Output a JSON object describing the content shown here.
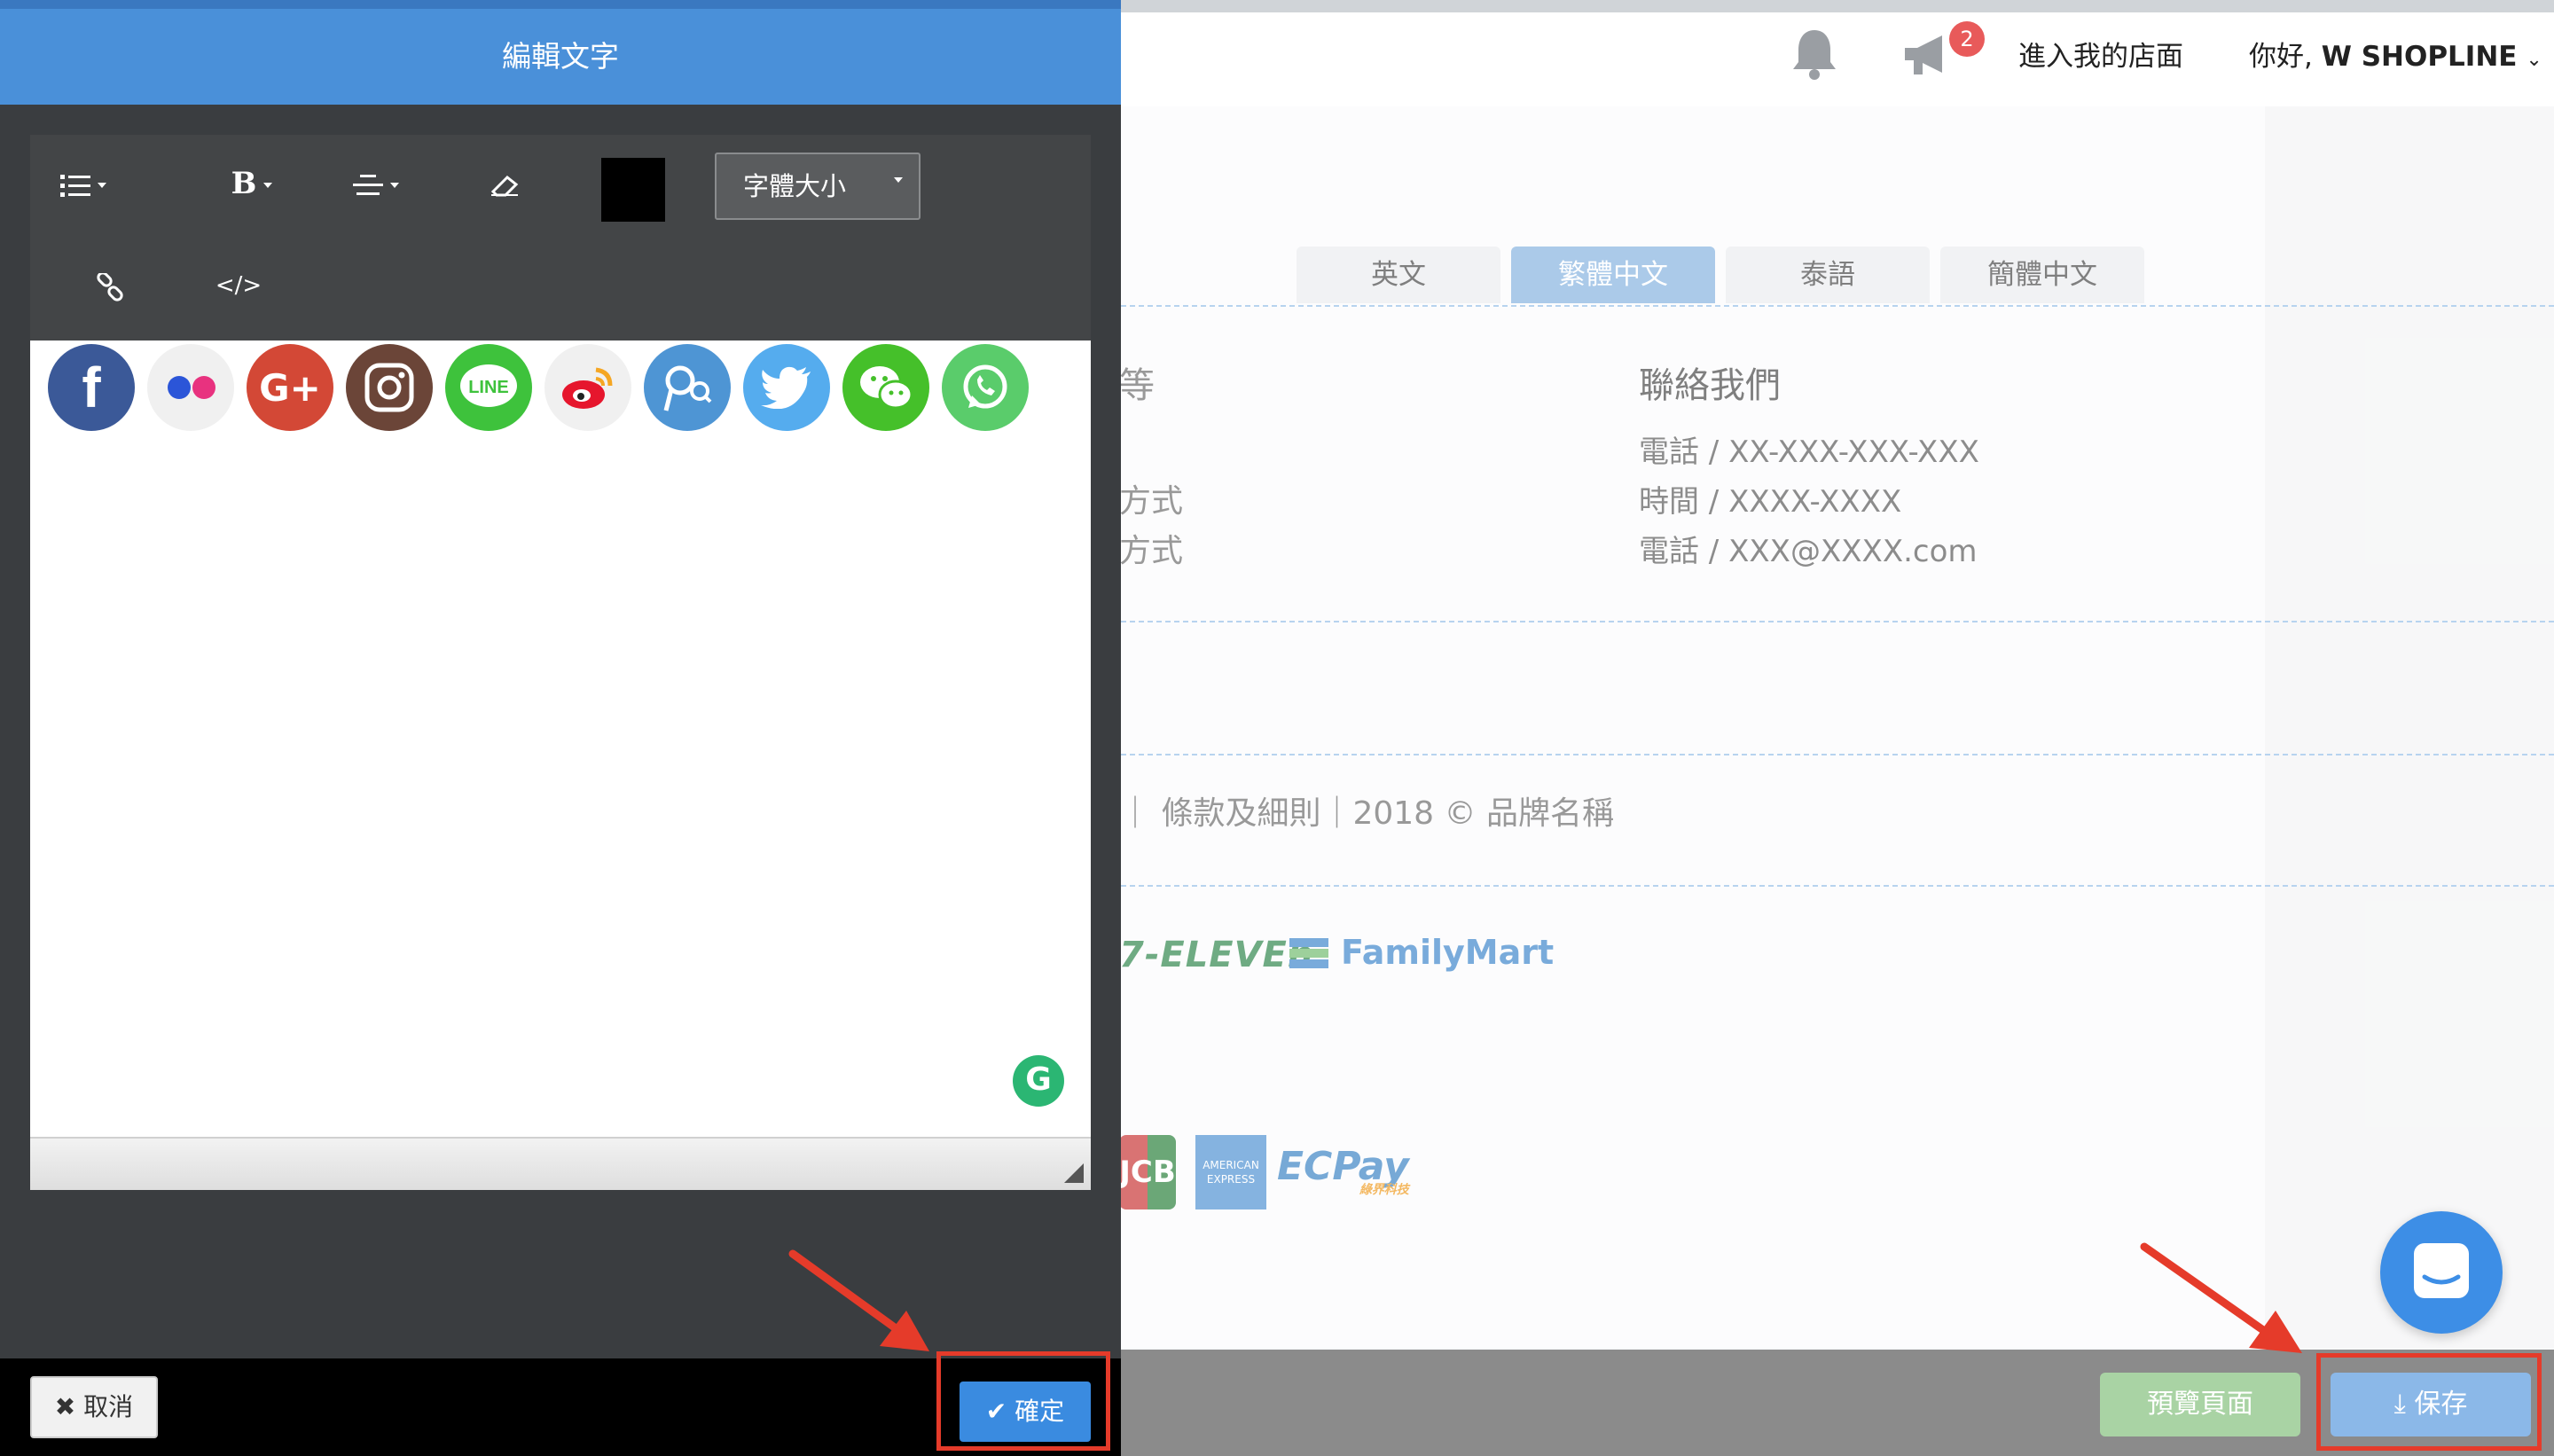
{
  "modal": {
    "title": "編輯文字",
    "toolbar": {
      "font_size_label": "字體大小",
      "text_color": "#000000"
    },
    "editor": {
      "social_icons": [
        "facebook-icon",
        "flickr-icon",
        "google-plus-icon",
        "instagram-icon",
        "line-icon",
        "weibo-icon",
        "pixnet-icon",
        "twitter-icon",
        "wechat-icon",
        "whatsapp-icon"
      ],
      "grammarly_label": "G"
    },
    "footer": {
      "cancel_label": "取消",
      "confirm_label": "確定"
    }
  },
  "header": {
    "notification_count": "2",
    "store_link": "進入我的店面",
    "greeting_prefix": "你好,",
    "user_name": "W SHOPLINE"
  },
  "lang_tabs": [
    {
      "label": "英文",
      "active": false
    },
    {
      "label": "繁體中文",
      "active": true
    },
    {
      "label": "泰語",
      "active": false
    },
    {
      "label": "簡體中文",
      "active": false
    }
  ],
  "footer_preview": {
    "contact_title": "聯絡我們",
    "contact_lines": [
      "電話 / XX-XXX-XXX-XXX",
      "時間 / XXXX-XXXX",
      "電話 / XXX@XXXX.com"
    ],
    "left_partial_title": "等",
    "left_partial_lines": [
      "方式",
      "方式"
    ],
    "copyright": "｜ 條款及細則｜2018 © 品牌名稱",
    "logistics": [
      "7-ELEVEn.",
      "FamilyMart"
    ],
    "payments": [
      "JCB",
      "AMERICAN EXPRESS",
      "ECPay"
    ],
    "ecpay_sub": "綠界科技"
  },
  "actions": {
    "preview_label": "預覽頁面",
    "save_label": "保存"
  },
  "colors": {
    "modal_header": "#4a90d9",
    "annotation": "#e53b2a",
    "save_button": "#8bb8e8",
    "preview_button": "#a9d3a4"
  }
}
